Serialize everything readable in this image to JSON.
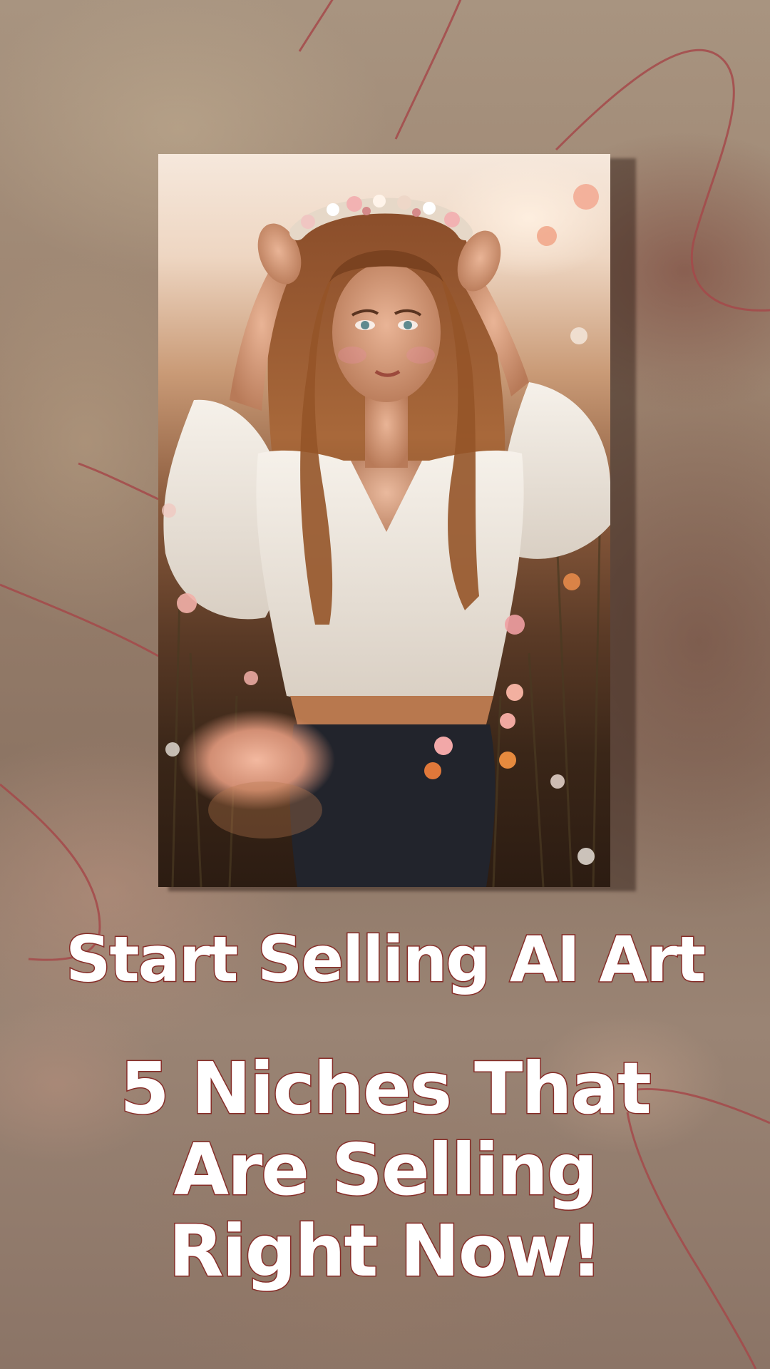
{
  "headline": {
    "line1": "Start Selling AI Art",
    "line2": "5 Niches That",
    "line3": "Are Selling",
    "line4": "Right Now!"
  },
  "colors": {
    "text_fill": "#ffffff",
    "text_outline": "#8a2f2a",
    "accent_curve": "#a5494a",
    "background": "#9b826e"
  },
  "photo": {
    "subject": "woman with flower crown in a field of flowers"
  }
}
